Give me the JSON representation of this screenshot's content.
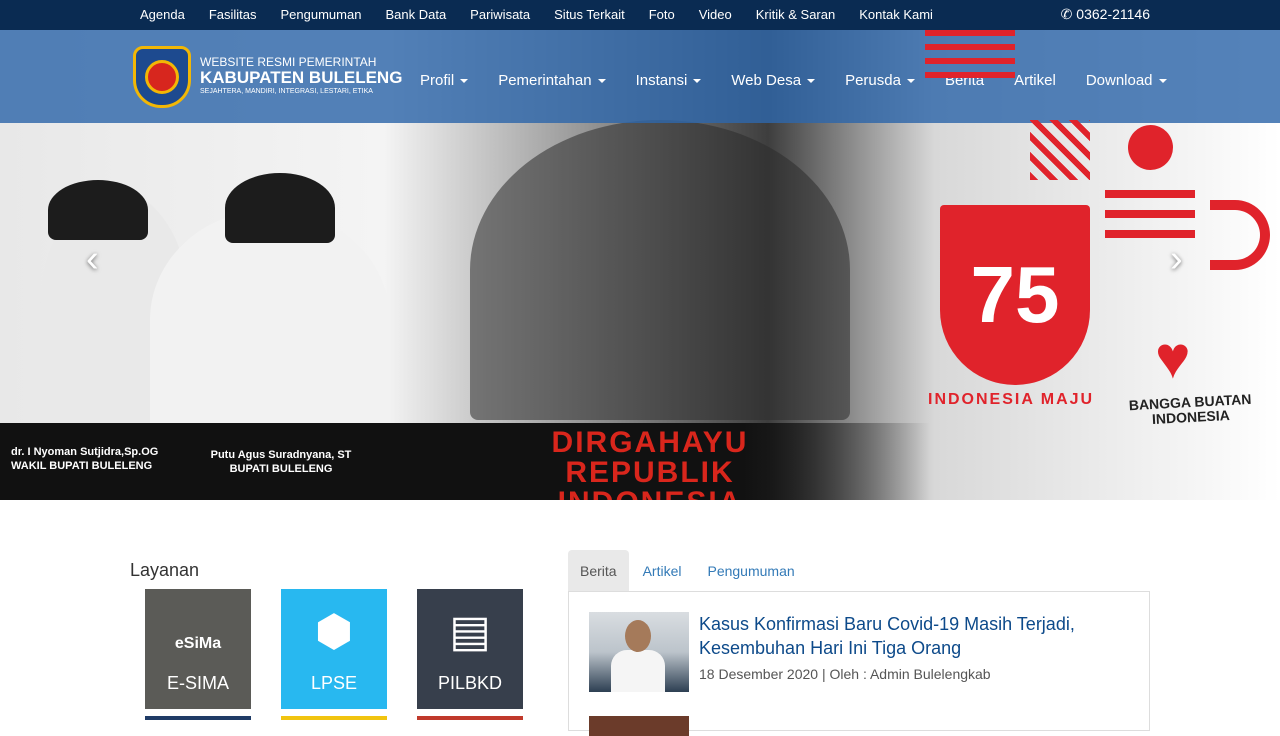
{
  "topbar": {
    "links": [
      "Agenda",
      "Fasilitas",
      "Pengumuman",
      "Bank Data",
      "Pariwisata",
      "Situs Terkait",
      "Foto",
      "Video",
      "Kritik & Saran",
      "Kontak Kami"
    ],
    "phone_icon": "phone-icon",
    "phone": "0362-21146"
  },
  "logo": {
    "line1": "WEBSITE RESMI PEMERINTAH",
    "line2": "KABUPATEN BULELENG",
    "line3": "SEJAHTERA, MANDIRI, INTEGRASI, LESTARI, ETIKA"
  },
  "nav": {
    "items": [
      {
        "label": "Profil",
        "dropdown": true
      },
      {
        "label": "Pemerintahan",
        "dropdown": true
      },
      {
        "label": "Instansi",
        "dropdown": true
      },
      {
        "label": "Web Desa",
        "dropdown": true
      },
      {
        "label": "Perusda",
        "dropdown": true
      },
      {
        "label": "Berita",
        "dropdown": false
      },
      {
        "label": "Artikel",
        "dropdown": false
      },
      {
        "label": "Download",
        "dropdown": true
      }
    ]
  },
  "banner": {
    "headline_1": "DIRGAHAYU",
    "headline_2": "REPUBLIK INDONESIA",
    "left_name": "dr. I Nyoman Sutjidra,Sp.OG",
    "left_role": "WAKIL BUPATI BULELENG",
    "right_name": "Putu Agus Suradnyana, ST",
    "right_role": "BUPATI BULELENG",
    "logo_number": "75",
    "logo_caption": "INDONESIA MAJU",
    "bangga": "BANGGA BUATAN INDONESIA",
    "prev_icon": "chevron-left-icon",
    "next_icon": "chevron-right-icon"
  },
  "layanan": {
    "title": "Layanan",
    "tiles": [
      {
        "label": "E-SIMA",
        "color": "#5b5b57",
        "icon": "esima-logo"
      },
      {
        "label": "LPSE",
        "color": "#28b8f0",
        "icon": "hexagon-icon"
      },
      {
        "label": "PILBKD",
        "color": "#373f4c",
        "icon": "document-icon"
      }
    ],
    "esima_brand": "eSiMa"
  },
  "news": {
    "tabs": [
      "Berita",
      "Artikel",
      "Pengumuman"
    ],
    "active_tab": "Berita",
    "items": [
      {
        "title": "Kasus Konfirmasi Baru Covid-19 Masih Terjadi, Kesembuhan Hari Ini Tiga Orang",
        "meta": "18 Desember 2020 | Oleh : Admin Bulelengkab"
      }
    ]
  }
}
